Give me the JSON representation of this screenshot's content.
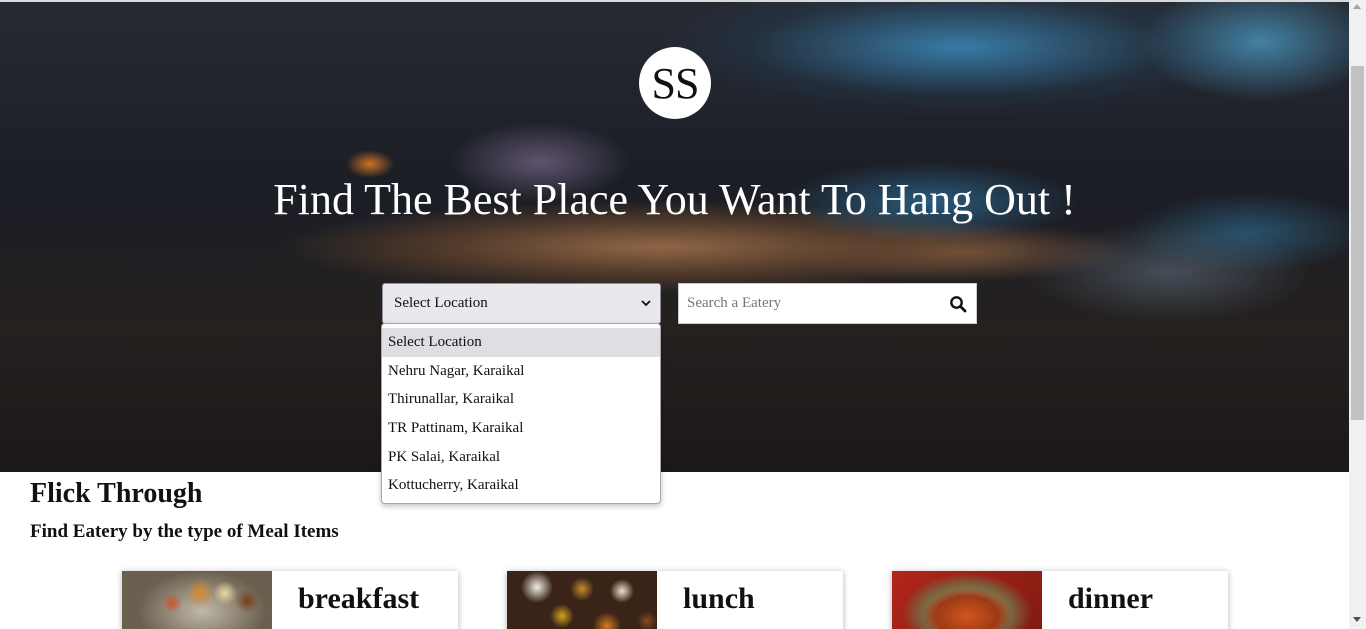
{
  "hero": {
    "logo_text": "SS",
    "title": "Find The Best Place You Want To Hang Out !"
  },
  "location_select": {
    "selected": "Select Location",
    "options": [
      "Select Location",
      "Nehru Nagar, Karaikal",
      "Thirunallar, Karaikal",
      "TR Pattinam, Karaikal",
      "PK Salai, Karaikal",
      "Kottucherry, Karaikal"
    ]
  },
  "search": {
    "placeholder": "Search a Eatery",
    "icon": "search-icon"
  },
  "flick": {
    "title": "Flick Through",
    "subtitle": "Find Eatery by the type of Meal Items"
  },
  "meals": [
    {
      "label": "breakfast"
    },
    {
      "label": "lunch"
    },
    {
      "label": "dinner"
    }
  ],
  "colors": {
    "select_bg": "#e9e9ed",
    "dropdown_highlight": "#dedee3",
    "text": "#111111"
  }
}
